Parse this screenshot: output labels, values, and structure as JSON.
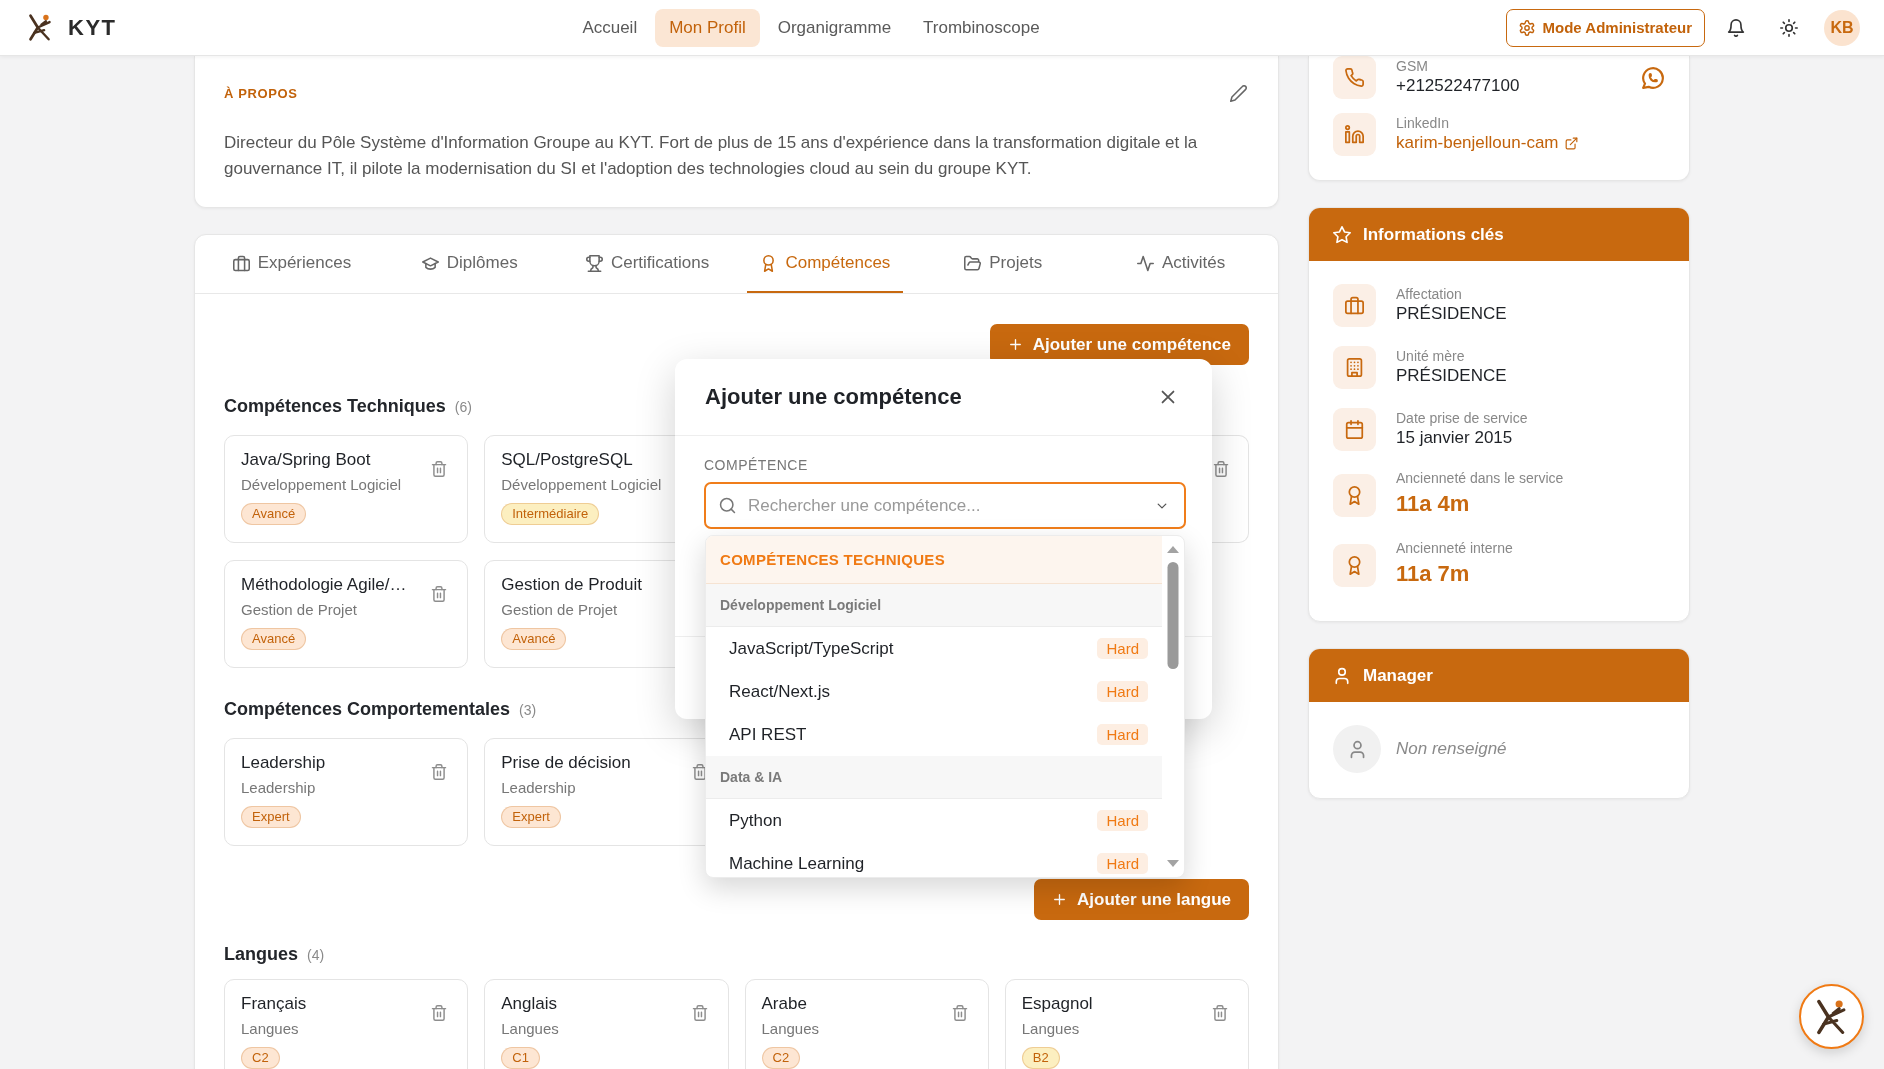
{
  "header": {
    "brand": "KYT",
    "nav": [
      {
        "label": "Accueil",
        "selected": false
      },
      {
        "label": "Mon Profil",
        "selected": true
      },
      {
        "label": "Organigramme",
        "selected": false
      },
      {
        "label": "Trombinoscope",
        "selected": false
      }
    ],
    "admin_button": "Mode Administrateur",
    "avatar": "KB"
  },
  "about": {
    "title": "À PROPOS",
    "text": "Directeur du Pôle Système d'Information Groupe au KYT. Fort de plus de 15 ans d'expérience dans la transformation digitale et la gouvernance IT, il pilote la modernisation du SI et l'adoption des technologies cloud au sein du groupe KYT."
  },
  "tabs": [
    {
      "label": "Expériences",
      "selected": false
    },
    {
      "label": "Diplômes",
      "selected": false
    },
    {
      "label": "Certifications",
      "selected": false
    },
    {
      "label": "Compétences",
      "selected": true
    },
    {
      "label": "Projets",
      "selected": false
    },
    {
      "label": "Activités",
      "selected": false
    }
  ],
  "skills": {
    "add_button": "Ajouter une compétence",
    "sections": [
      {
        "title": "Compétences Techniques",
        "count": "(6)",
        "cards": [
          {
            "kind": "full",
            "name": "Java/Spring Boot",
            "category": "Développement Logiciel",
            "proficiency": "Avancé",
            "color": "#fde6d3",
            "delete_icon": true
          },
          {
            "kind": "full",
            "name": "SQL/PostgreSQL",
            "category": "Développement Logiciel",
            "proficiency": "Intermédiaire",
            "color": "#fcefc0",
            "delete_icon": false
          },
          {
            "kind": "edge",
            "delete_icon": true
          },
          {
            "kind": "full",
            "name": "Méthodologie Agile/…",
            "category": "Gestion de Projet",
            "proficiency": "Avancé",
            "color": "#fde6d3",
            "delete_icon": true
          },
          {
            "kind": "full",
            "name": "Gestion de Produit",
            "category": "Gestion de Projet",
            "proficiency": "Avancé",
            "color": "#fde6d3",
            "delete_icon": false
          }
        ]
      },
      {
        "title": "Compétences Comportementales",
        "count": "(3)",
        "cards": [
          {
            "kind": "full",
            "name": "Leadership",
            "category": "Leadership",
            "proficiency": "Expert",
            "color": "#fde6d3",
            "delete_icon": true
          },
          {
            "kind": "full",
            "name": "Prise de décision",
            "category": "Leadership",
            "proficiency": "Expert",
            "color": "#fde6d3",
            "delete_icon": true
          }
        ]
      }
    ]
  },
  "languages": {
    "add_button": "Ajouter une langue",
    "title": "Langues",
    "count": "(4)",
    "cards": [
      {
        "kind": "full",
        "name": "Français",
        "category": "Langues",
        "proficiency": "C2",
        "color": "#fde6d3",
        "delete_icon": true
      },
      {
        "kind": "full",
        "name": "Anglais",
        "category": "Langues",
        "proficiency": "C1",
        "color": "#fde6d3",
        "delete_icon": true
      },
      {
        "kind": "full",
        "name": "Arabe",
        "category": "Langues",
        "proficiency": "C2",
        "color": "#fde6d3",
        "delete_icon": true
      },
      {
        "kind": "full",
        "name": "Espagnol",
        "category": "Langues",
        "proficiency": "B2",
        "color": "#fcefc0",
        "delete_icon": true
      }
    ]
  },
  "modal": {
    "title": "Ajouter une compétence",
    "field_label": "COMPÉTENCE",
    "search": {
      "placeholder": "Rechercher une compétence..."
    },
    "dropdown": {
      "groups": [
        {
          "title": "COMPÉTENCES TECHNIQUES",
          "subgroups": [
            {
              "title": "Développement Logiciel",
              "options": [
                {
                  "label": "JavaScript/TypeScript",
                  "tag": "Hard"
                },
                {
                  "label": "React/Next.js",
                  "tag": "Hard"
                },
                {
                  "label": "API REST",
                  "tag": "Hard"
                }
              ]
            },
            {
              "title": "Data & IA",
              "options": [
                {
                  "label": "Python",
                  "tag": "Hard"
                },
                {
                  "label": "Machine Learning",
                  "tag": "Hard"
                }
              ]
            }
          ]
        }
      ]
    }
  },
  "contact": {
    "rows": [
      {
        "kind": "phone",
        "label": "GSM",
        "value": "+212522477100"
      },
      {
        "kind": "link",
        "label": "LinkedIn",
        "value": "karim-benjelloun-cam"
      }
    ]
  },
  "key_info": {
    "title": "Informations clés",
    "rows": [
      {
        "kind": "plain",
        "label": "Affectation",
        "value": "PRÉSIDENCE"
      },
      {
        "kind": "plain",
        "label": "Unité mère",
        "value": "PRÉSIDENCE"
      },
      {
        "kind": "plain",
        "label": "Date prise de service",
        "value": "15 janvier 2015"
      },
      {
        "kind": "highlight",
        "label": "Ancienneté dans le service",
        "value": "11a 4m"
      },
      {
        "kind": "highlight",
        "label": "Ancienneté interne",
        "value": "11a 7m"
      }
    ]
  },
  "manager": {
    "title": "Manager",
    "value": "Non renseigné"
  }
}
